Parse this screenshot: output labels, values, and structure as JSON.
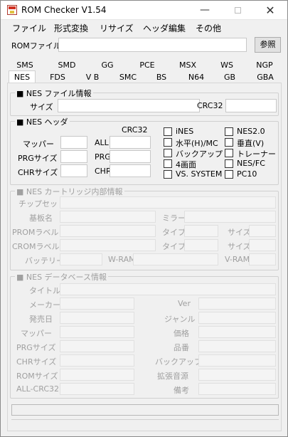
{
  "window": {
    "title": "ROM Checker V1.54"
  },
  "menu": [
    "ファイル",
    "形式変換",
    "リサイズ",
    "ヘッダ編集",
    "その他"
  ],
  "rom_file": {
    "label": "ROMファイル",
    "value": "",
    "browse_label": "参照"
  },
  "tabs_row1": [
    "SMS",
    "SMD",
    "GG",
    "PCE",
    "MSX",
    "WS",
    "NGP"
  ],
  "tabs_row2": [
    "NES",
    "FDS",
    "V B",
    "SMC",
    "BS",
    "N64",
    "GB",
    "GBA"
  ],
  "active_tab": "NES",
  "file_info": {
    "title": "■ NES ファイル情報",
    "size_label": "サイズ",
    "crc_label": "CRC32"
  },
  "header": {
    "title": "■ NES ヘッダ",
    "crc_col": "CRC32",
    "mapper": "マッパー",
    "prg_size": "PRGサイズ",
    "chr_size": "CHRサイズ",
    "all": "ALL",
    "prg": "PRG",
    "chr": "CHR",
    "checks_left": [
      "iNES",
      "水平(H)/MC",
      "バックアップ",
      "4画面",
      "VS. SYSTEM"
    ],
    "checks_right": [
      "NES2.0",
      "垂直(V)",
      "トレーナー",
      "NES/FC",
      "PC10"
    ]
  },
  "cart": {
    "title": "■ NES カートリッジ内部情報",
    "chipset": "チップセット",
    "board": "基板名",
    "mirror": "ミラー",
    "prom_label": "PROMラベル",
    "crom_label": "CROMラベル",
    "type": "タイプ",
    "size": "サイズ",
    "battery": "バッテリー",
    "wram": "W-RAM",
    "vram": "V-RAM"
  },
  "db": {
    "title": "■ NES データベース情報",
    "left": [
      "タイトル",
      "メーカー",
      "発売日",
      "マッパー",
      "PRGサイズ",
      "CHRサイズ",
      "ROMサイズ",
      "ALL-CRC32"
    ],
    "right": [
      "Ver",
      "ジャンル",
      "価格",
      "品番",
      "バックアップ",
      "拡張音源",
      "備考"
    ]
  }
}
